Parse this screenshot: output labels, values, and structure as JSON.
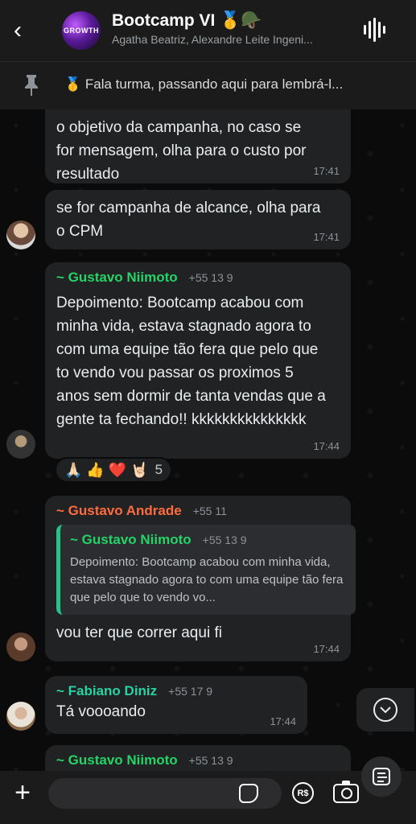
{
  "header": {
    "back_icon": "chevron-left-icon",
    "avatar_text": "GROWTH",
    "title": "Bootcamp VI 🥇🪖",
    "subtitle": "Agatha Beatriz, Alexandre Leite Ingeni...",
    "audio_icon": "audio-waveform-icon"
  },
  "pinned": {
    "icon": "pin-icon",
    "text": "🥇 Fala turma, passando aqui para lembrá-l..."
  },
  "messages": [
    {
      "text": "o objetivo da campanha, no caso se for mensagem, olha para o custo por resultado",
      "time": "17:41"
    },
    {
      "text": "se for campanha de alcance, olha para o CPM",
      "time": "17:41"
    },
    {
      "sender": "~ Gustavo Niimoto",
      "phone": "+55 13 9",
      "text": "Depoimento: Bootcamp acabou com minha vida, estava stagnado agora to com uma equipe tão fera que pelo que to vendo vou passar os proximos 5 anos sem dormir de tanta vendas que a gente ta fechando!! kkkkkkkkkkkkkkk",
      "time": "17:44",
      "reactions": {
        "emojis": "🙏🏻 👍 ❤️ 🤘🏻",
        "count": "5"
      }
    },
    {
      "sender": "~ Gustavo Andrade",
      "phone": "+55 11",
      "quote": {
        "sender": "~ Gustavo Niimoto",
        "phone": "+55 13 9",
        "text": "Depoimento: Bootcamp acabou com minha vida, estava stagnado agora to com uma equipe tão fera que pelo que to vendo vo..."
      },
      "text": "vou ter que correr aqui fi",
      "time": "17:44"
    },
    {
      "sender": "~ Fabiano Diniz",
      "phone": "+55 17 9",
      "text": "Tá voooando",
      "time": "17:44"
    },
    {
      "sender": "~ Gustavo Niimoto",
      "phone": "+55 13 9"
    }
  ],
  "colors": {
    "niimoto": "#25d366",
    "andrade": "#ff6b3d",
    "fabiano": "#2ad1a3"
  },
  "input": {
    "placeholder": "",
    "pay_label": "R$"
  }
}
